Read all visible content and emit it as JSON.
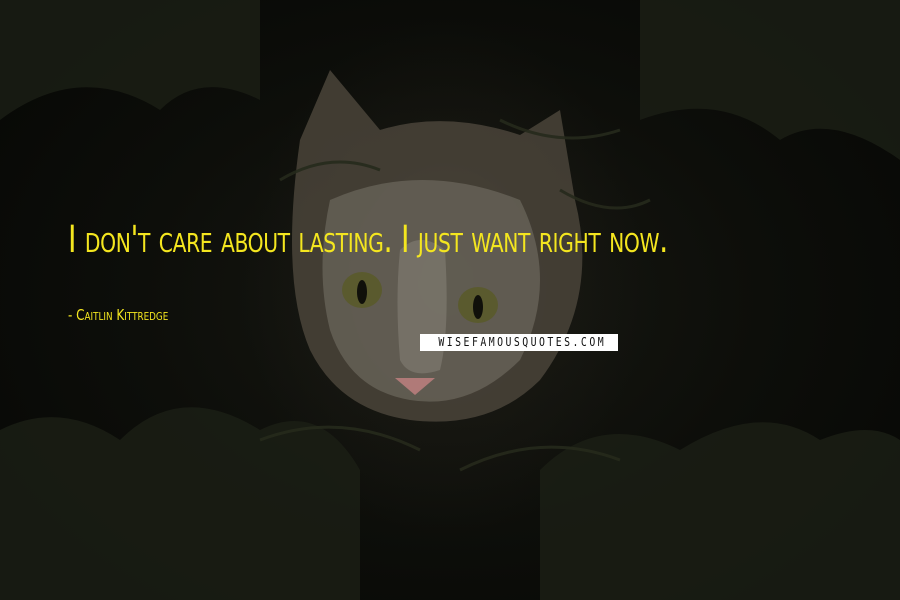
{
  "quote": {
    "text": "I don't care about lasting. I just want right now.",
    "author": "- Caitlin Kittredge"
  },
  "watermark": {
    "text": "WISEFAMOUSQUOTES.COM"
  },
  "background": {
    "subject": "kitten-peeking-through-foliage",
    "text_color": "#f4e61f",
    "base_color": "#0b0c08"
  }
}
